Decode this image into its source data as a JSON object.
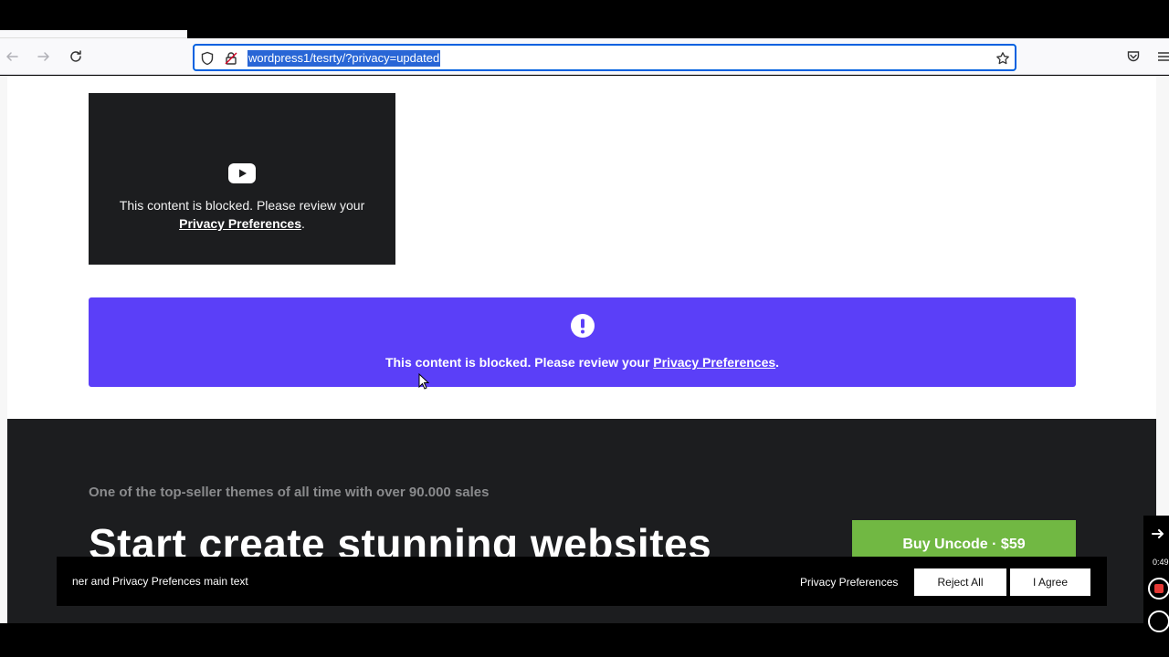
{
  "browser": {
    "url": "wordpress1/tesrty/?privacy=updated",
    "icons": [
      "back-arrow-icon",
      "forward-arrow-icon",
      "reload-icon",
      "shield-icon",
      "lock-icon",
      "bookmark-star-icon",
      "pocket-icon",
      "menu-icon"
    ]
  },
  "video_block": {
    "icon": "youtube-icon",
    "text_before": "This content is blocked. Please review your ",
    "link": "Privacy Preferences",
    "text_after": "."
  },
  "purple_banner": {
    "icon": "alert-icon",
    "text_before": "This content is blocked. Please review your ",
    "link": "Privacy Preferences",
    "text_after": ".",
    "color": "#5b3ff8"
  },
  "promo": {
    "subtitle": "One of the top-seller themes of all time with over 90.000 sales",
    "title": "Start create stunning websites",
    "buy_button": "Buy Uncode · $59",
    "button_color": "#71b843"
  },
  "consent_bar": {
    "text": "ner and Privacy Prefences main text",
    "preferences_link": "Privacy Preferences",
    "reject_button": "Reject All",
    "agree_button": "I Agree"
  },
  "recorder": {
    "time": "0:49"
  }
}
